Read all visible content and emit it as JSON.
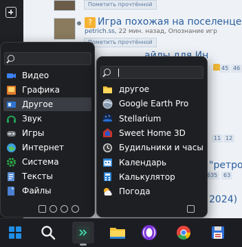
{
  "background_page": {
    "mark_read_label": "Пометить прочтённой",
    "topic_title": "Игра похожая на поселенцев д",
    "topic_author": "petrich.ss",
    "topic_meta": ", 22 мин. назад, Опознание игр",
    "partial_title_1": "айлы для Ин",
    "partial_title_2": "\"ретрок",
    "partial_title_3": "2024)",
    "page_chips": [
      "45",
      "46",
      "11",
      "12",
      "635",
      "63"
    ]
  },
  "left_menu": {
    "search_value": "",
    "items": [
      {
        "label": "Видео",
        "icon": "video-icon",
        "color": "#3b82f6"
      },
      {
        "label": "Графика",
        "icon": "graphics-icon",
        "color": "#e07a2a"
      },
      {
        "label": "Другое",
        "icon": "other-icon",
        "color": "#2f74d0"
      },
      {
        "label": "Звук",
        "icon": "sound-icon",
        "color": "#22a35a"
      },
      {
        "label": "Игры",
        "icon": "games-icon",
        "color": "#5a5f66"
      },
      {
        "label": "Интернет",
        "icon": "internet-icon",
        "color": "#3aa0e0"
      },
      {
        "label": "Система",
        "icon": "system-icon",
        "color": "#2db34a"
      },
      {
        "label": "Тексты",
        "icon": "texts-icon",
        "color": "#5b8fd8"
      },
      {
        "label": "Файлы",
        "icon": "files-icon",
        "color": "#4c7fd1"
      }
    ],
    "selected_index": 2
  },
  "right_menu": {
    "search_value": "",
    "items": [
      {
        "label": "другое",
        "icon": "folder-icon"
      },
      {
        "label": "Google Earth Pro",
        "icon": "google-earth-icon"
      },
      {
        "label": "Stellarium",
        "icon": "stellarium-icon"
      },
      {
        "label": "Sweet Home 3D",
        "icon": "sweet-home-3d-icon"
      },
      {
        "label": "Будильники и часы",
        "icon": "alarms-clock-icon"
      },
      {
        "label": "Календарь",
        "icon": "calendar-icon"
      },
      {
        "label": "Калькулятор",
        "icon": "calculator-icon"
      },
      {
        "label": "Погода",
        "icon": "weather-icon"
      }
    ]
  },
  "taskbar": {
    "apps": [
      "windows-start-icon",
      "search-icon",
      "terminal-app-icon",
      "file-explorer-icon",
      "opera-icon",
      "chrome-icon",
      "save-app-icon"
    ]
  }
}
